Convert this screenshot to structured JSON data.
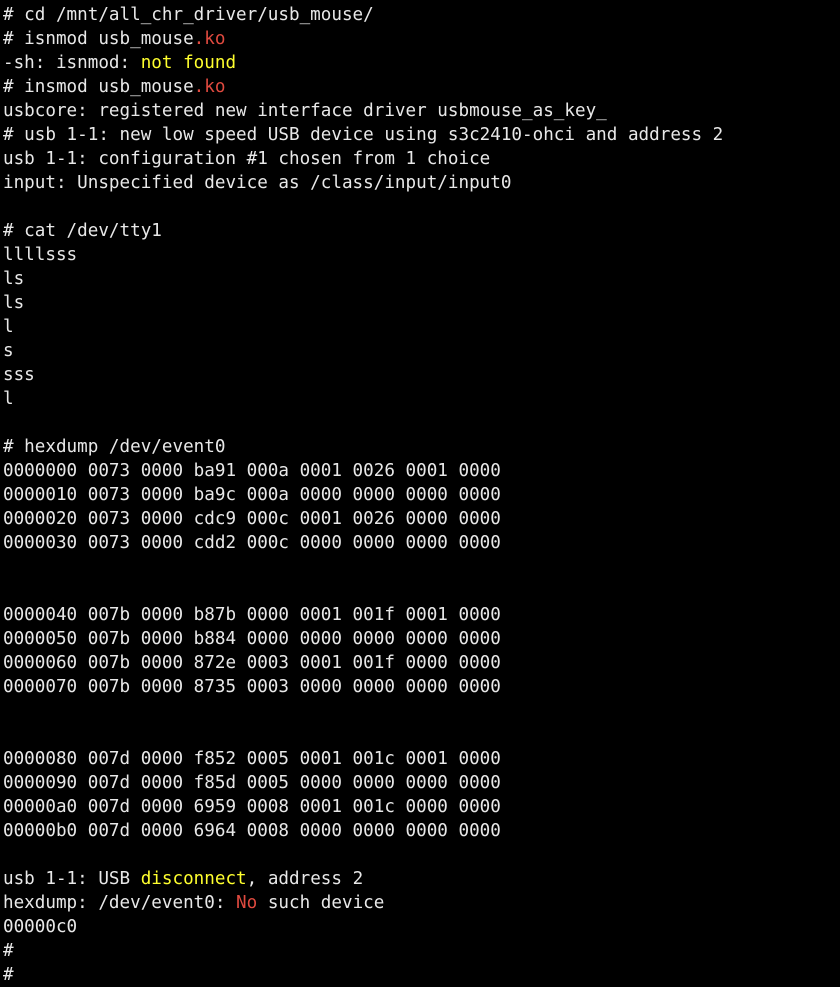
{
  "terminal": {
    "title": "Serial Terminal - Embedded Linux Shell",
    "background_color": "#000000",
    "default_text_color": "#e8e8e8",
    "accent_colors": {
      "red": "#e04a3f",
      "yellow": "#ffff2e"
    },
    "prompt": "#",
    "font_size_px": 17.6,
    "line_height_px": 24,
    "lines": [
      {
        "segments": [
          {
            "text": "# cd /mnt/all_chr_driver/usb_mouse/",
            "color": "default"
          }
        ]
      },
      {
        "segments": [
          {
            "text": "# isnmod usb_mouse",
            "color": "default"
          },
          {
            "text": ".ko",
            "color": "red"
          }
        ]
      },
      {
        "segments": [
          {
            "text": "-sh: isnmod: ",
            "color": "default"
          },
          {
            "text": "not found",
            "color": "yellow"
          }
        ]
      },
      {
        "segments": [
          {
            "text": "# insmod usb_mouse",
            "color": "default"
          },
          {
            "text": ".ko",
            "color": "red"
          }
        ]
      },
      {
        "segments": [
          {
            "text": "usbcore: registered new interface driver usbmouse_as_key_",
            "color": "default"
          }
        ]
      },
      {
        "segments": [
          {
            "text": "# usb 1-1: new low speed USB device using s3c2410-ohci and address 2",
            "color": "default"
          }
        ]
      },
      {
        "segments": [
          {
            "text": "usb 1-1: configuration #1 chosen from 1 choice",
            "color": "default"
          }
        ]
      },
      {
        "segments": [
          {
            "text": "input: Unspecified device as /class/input/input0",
            "color": "default"
          }
        ]
      },
      {
        "segments": []
      },
      {
        "segments": [
          {
            "text": "# cat /dev/tty1",
            "color": "default"
          }
        ]
      },
      {
        "segments": [
          {
            "text": "llllsss",
            "color": "default"
          }
        ]
      },
      {
        "segments": [
          {
            "text": "ls",
            "color": "default"
          }
        ]
      },
      {
        "segments": [
          {
            "text": "ls",
            "color": "default"
          }
        ]
      },
      {
        "segments": [
          {
            "text": "l",
            "color": "default"
          }
        ]
      },
      {
        "segments": [
          {
            "text": "s",
            "color": "default"
          }
        ]
      },
      {
        "segments": [
          {
            "text": "sss",
            "color": "default"
          }
        ]
      },
      {
        "segments": [
          {
            "text": "l",
            "color": "default"
          }
        ]
      },
      {
        "segments": []
      },
      {
        "segments": [
          {
            "text": "# hexdump /dev/event0",
            "color": "default"
          }
        ]
      },
      {
        "segments": [
          {
            "text": "0000000 0073 0000 ba91 000a 0001 0026 0001 0000",
            "color": "default"
          }
        ]
      },
      {
        "segments": [
          {
            "text": "0000010 0073 0000 ba9c 000a 0000 0000 0000 0000",
            "color": "default"
          }
        ]
      },
      {
        "segments": [
          {
            "text": "0000020 0073 0000 cdc9 000c 0001 0026 0000 0000",
            "color": "default"
          }
        ]
      },
      {
        "segments": [
          {
            "text": "0000030 0073 0000 cdd2 000c 0000 0000 0000 0000",
            "color": "default"
          }
        ]
      },
      {
        "segments": []
      },
      {
        "segments": []
      },
      {
        "segments": [
          {
            "text": "0000040 007b 0000 b87b 0000 0001 001f 0001 0000",
            "color": "default"
          }
        ]
      },
      {
        "segments": [
          {
            "text": "0000050 007b 0000 b884 0000 0000 0000 0000 0000",
            "color": "default"
          }
        ]
      },
      {
        "segments": [
          {
            "text": "0000060 007b 0000 872e 0003 0001 001f 0000 0000",
            "color": "default"
          }
        ]
      },
      {
        "segments": [
          {
            "text": "0000070 007b 0000 8735 0003 0000 0000 0000 0000",
            "color": "default"
          }
        ]
      },
      {
        "segments": []
      },
      {
        "segments": []
      },
      {
        "segments": [
          {
            "text": "0000080 007d 0000 f852 0005 0001 001c 0001 0000",
            "color": "default"
          }
        ]
      },
      {
        "segments": [
          {
            "text": "0000090 007d 0000 f85d 0005 0000 0000 0000 0000",
            "color": "default"
          }
        ]
      },
      {
        "segments": [
          {
            "text": "00000a0 007d 0000 6959 0008 0001 001c 0000 0000",
            "color": "default"
          }
        ]
      },
      {
        "segments": [
          {
            "text": "00000b0 007d 0000 6964 0008 0000 0000 0000 0000",
            "color": "default"
          }
        ]
      },
      {
        "segments": []
      },
      {
        "segments": [
          {
            "text": "usb 1-1: USB ",
            "color": "default"
          },
          {
            "text": "disconnect",
            "color": "yellow"
          },
          {
            "text": ", address 2",
            "color": "default"
          }
        ]
      },
      {
        "segments": [
          {
            "text": "hexdump: /dev/event0: ",
            "color": "default"
          },
          {
            "text": "No",
            "color": "red"
          },
          {
            "text": " such device",
            "color": "default"
          }
        ]
      },
      {
        "segments": [
          {
            "text": "00000c0",
            "color": "default"
          }
        ]
      },
      {
        "segments": [
          {
            "text": "#",
            "color": "default"
          }
        ]
      },
      {
        "segments": [
          {
            "text": "#",
            "color": "default"
          }
        ]
      }
    ]
  }
}
